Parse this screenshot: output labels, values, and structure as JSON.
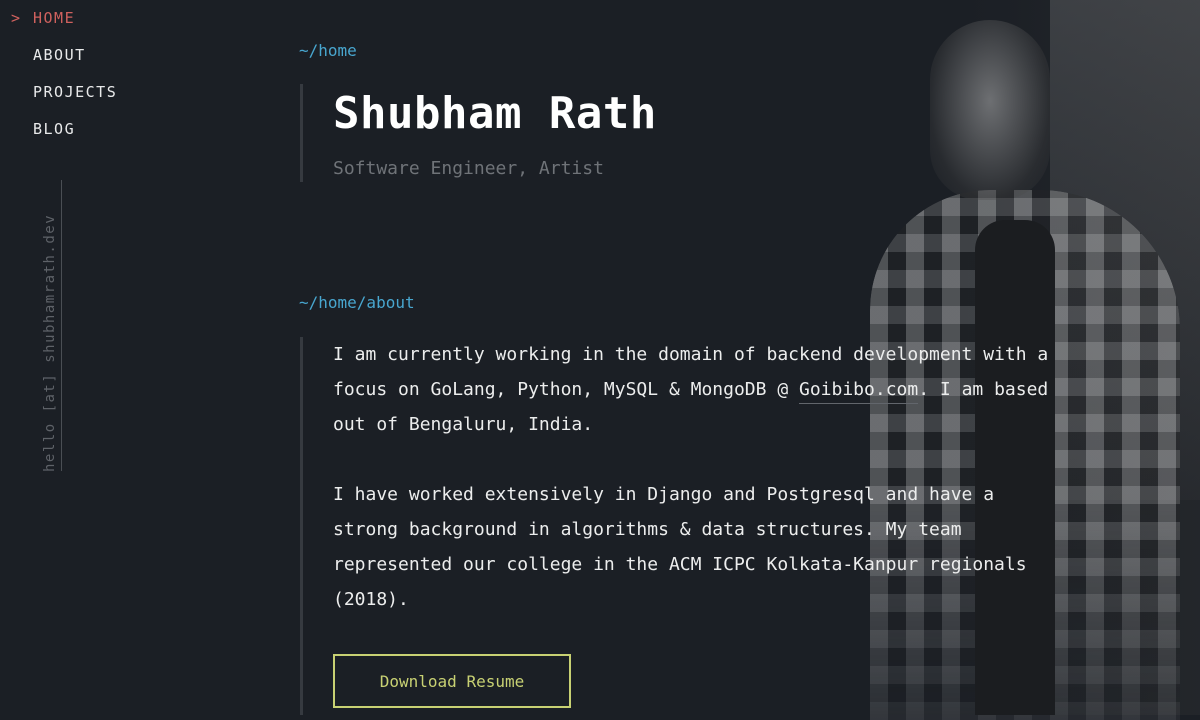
{
  "nav": {
    "caret": ">",
    "items": [
      {
        "label": "HOME",
        "active": true
      },
      {
        "label": "ABOUT",
        "active": false
      },
      {
        "label": "PROJECTS",
        "active": false
      },
      {
        "label": "BLOG",
        "active": false
      }
    ]
  },
  "sidebar": {
    "email": "hello [at] shubhamrath.dev"
  },
  "home": {
    "path": "~/home",
    "name": "Shubham Rath",
    "subtitle": "Software Engineer, Artist"
  },
  "about": {
    "path": "~/home/about",
    "p1_before": "I am currently working in the domain of backend development with a focus on GoLang, Python, MySQL & MongoDB @ ",
    "p1_link": "Goibibo.com",
    "p1_after": ". I am based out of Bengaluru, India.",
    "p2": "I have worked extensively in Django and Postgresql and have a strong background in algorithms & data structures. My team represented our college in the ACM ICPC Kolkata-Kanpur regionals (2018)."
  },
  "actions": {
    "resume_label": "Download Resume"
  },
  "colors": {
    "background": "#1b1f25",
    "active_nav": "#d0615e",
    "path": "#48a6cf",
    "button": "#c8d173"
  }
}
